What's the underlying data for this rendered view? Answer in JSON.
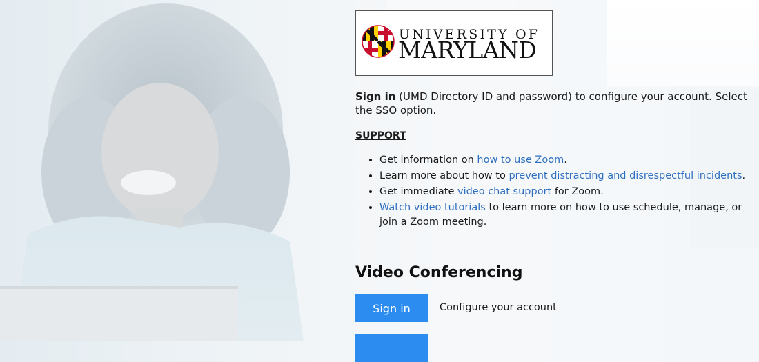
{
  "logo": {
    "line1": "UNIVERSITY OF",
    "line2": "MARYLAND"
  },
  "intro": {
    "bold": "Sign in",
    "text": " (UMD Directory ID and password) to configure your account. Select the SSO option."
  },
  "support": {
    "heading": "SUPPORT",
    "items": [
      {
        "pre": "Get information on ",
        "link": "how to use Zoom",
        "post": "."
      },
      {
        "pre": "Learn more about how to ",
        "link": "prevent distracting and disrespectful incidents",
        "post": "."
      },
      {
        "pre": "Get immediate ",
        "link": "video chat support",
        "post": " for Zoom."
      },
      {
        "pre": "",
        "link": "Watch video tutorials",
        "post": " to learn more on how to use schedule, manage, or join a Zoom meeting."
      }
    ]
  },
  "video_conferencing": {
    "heading": "Video Conferencing",
    "signin_button": "Sign in",
    "configure_text": "Configure your account",
    "second_button": ""
  },
  "colors": {
    "link": "#2f6fc0",
    "button": "#2d8cf0"
  }
}
